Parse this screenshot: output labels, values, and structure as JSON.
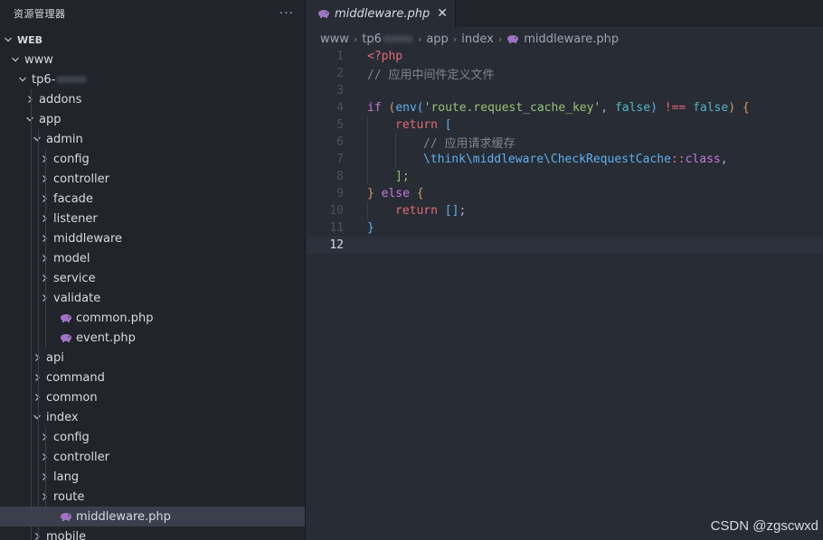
{
  "sidebar": {
    "title": "资源管理器",
    "more_glyph": "···",
    "tree": [
      {
        "label": "WEB",
        "type": "root"
      },
      {
        "label": "www",
        "type": "folder-open"
      },
      {
        "label": "tp6-",
        "type": "folder-open"
      },
      {
        "label": "addons",
        "type": "folder-closed"
      },
      {
        "label": "app",
        "type": "folder-open"
      },
      {
        "label": "admin",
        "type": "folder-open"
      },
      {
        "label": "config",
        "type": "folder-closed"
      },
      {
        "label": "controller",
        "type": "folder-closed"
      },
      {
        "label": "facade",
        "type": "folder-closed"
      },
      {
        "label": "listener",
        "type": "folder-closed"
      },
      {
        "label": "middleware",
        "type": "folder-closed"
      },
      {
        "label": "model",
        "type": "folder-closed"
      },
      {
        "label": "service",
        "type": "folder-closed"
      },
      {
        "label": "validate",
        "type": "folder-closed"
      },
      {
        "label": "common.php",
        "type": "php-file"
      },
      {
        "label": "event.php",
        "type": "php-file"
      },
      {
        "label": "api",
        "type": "folder-closed"
      },
      {
        "label": "command",
        "type": "folder-closed"
      },
      {
        "label": "common",
        "type": "folder-closed"
      },
      {
        "label": "index",
        "type": "folder-open"
      },
      {
        "label": "config",
        "type": "folder-closed"
      },
      {
        "label": "controller",
        "type": "folder-closed"
      },
      {
        "label": "lang",
        "type": "folder-closed"
      },
      {
        "label": "route",
        "type": "folder-closed"
      },
      {
        "label": "middleware.php",
        "type": "php-file",
        "selected": true
      },
      {
        "label": "mobile",
        "type": "folder-closed"
      }
    ]
  },
  "editor": {
    "tab": {
      "label": "middleware.php",
      "close_glyph": "✕",
      "icon": "php-elephant-icon"
    },
    "breadcrumb": [
      "www",
      "tp6",
      "app",
      "index",
      "middleware.php"
    ],
    "breadcrumb_sep": "›",
    "line_numbers": [
      "1",
      "2",
      "3",
      "4",
      "5",
      "6",
      "7",
      "8",
      "9",
      "10",
      "11",
      "12"
    ],
    "current_line": 12,
    "code": {
      "l1_open": "<?php",
      "l2_comment": "// 应用中间件定义文件",
      "l4_if": "if",
      "l4_paren_open": "(",
      "l4_env": "env",
      "l4_inner_open": "(",
      "l4_str": "'route.request_cache_key'",
      "l4_comma": ", ",
      "l4_false1": "false",
      "l4_inner_close": ")",
      "l4_op": " !== ",
      "l4_false2": "false",
      "l4_paren_close": ")",
      "l4_brace": " {",
      "l5_return": "return",
      "l5_bracket": " [",
      "l6_comment": "// 应用请求缓存",
      "l7_ns": "\\think\\middleware\\CheckRequestCache",
      "l7_colon": "::",
      "l7_class": "class",
      "l7_comma": ",",
      "l8_close": "];",
      "l9_close": "}",
      "l9_else": " else ",
      "l9_brace": "{",
      "l10_return": "return",
      "l10_arr": " []",
      "l10_semi": ";",
      "l11_close": "}"
    }
  },
  "watermark": "CSDN @zgscwxd",
  "colors": {
    "background": "#282c34",
    "sidebar": "#21252b",
    "keyword": "#c678dd",
    "string": "#98c379",
    "function": "#61afef",
    "comment": "#7f848e",
    "php_icon": "#a074c4"
  }
}
